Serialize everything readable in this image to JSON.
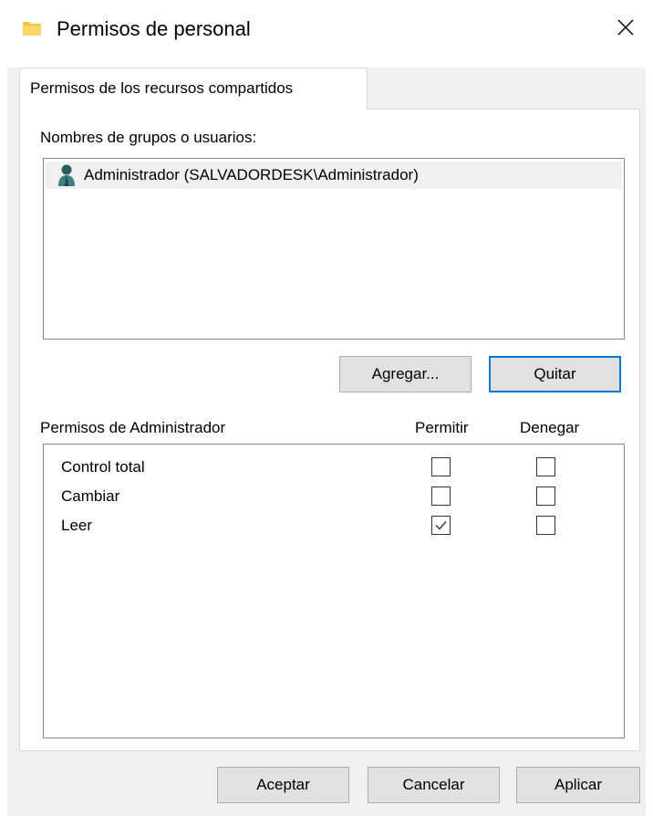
{
  "window": {
    "title": "Permisos de personal",
    "icons": {
      "app": "folder-icon",
      "close": "close-icon"
    }
  },
  "tabs": [
    {
      "label": "Permisos de los recursos compartidos",
      "selected": true
    }
  ],
  "users": {
    "label": "Nombres de grupos o usuarios:",
    "items": [
      {
        "name": "Administrador (SALVADORDESK\\Administrador)",
        "icon": "user-icon",
        "selected": true
      }
    ],
    "add_button": "Agregar...",
    "remove_button": "Quitar"
  },
  "permissions": {
    "label": "Permisos de Administrador",
    "allow_header": "Permitir",
    "deny_header": "Denegar",
    "rows": [
      {
        "name": "Control total",
        "allow": false,
        "deny": false
      },
      {
        "name": "Cambiar",
        "allow": false,
        "deny": false
      },
      {
        "name": "Leer",
        "allow": true,
        "deny": false
      }
    ]
  },
  "footer": {
    "ok": "Aceptar",
    "cancel": "Cancelar",
    "apply": "Aplicar"
  },
  "colors": {
    "accent": "#0078d7",
    "dialog_bg": "#f0f0f0",
    "folder": "#f4c542"
  }
}
